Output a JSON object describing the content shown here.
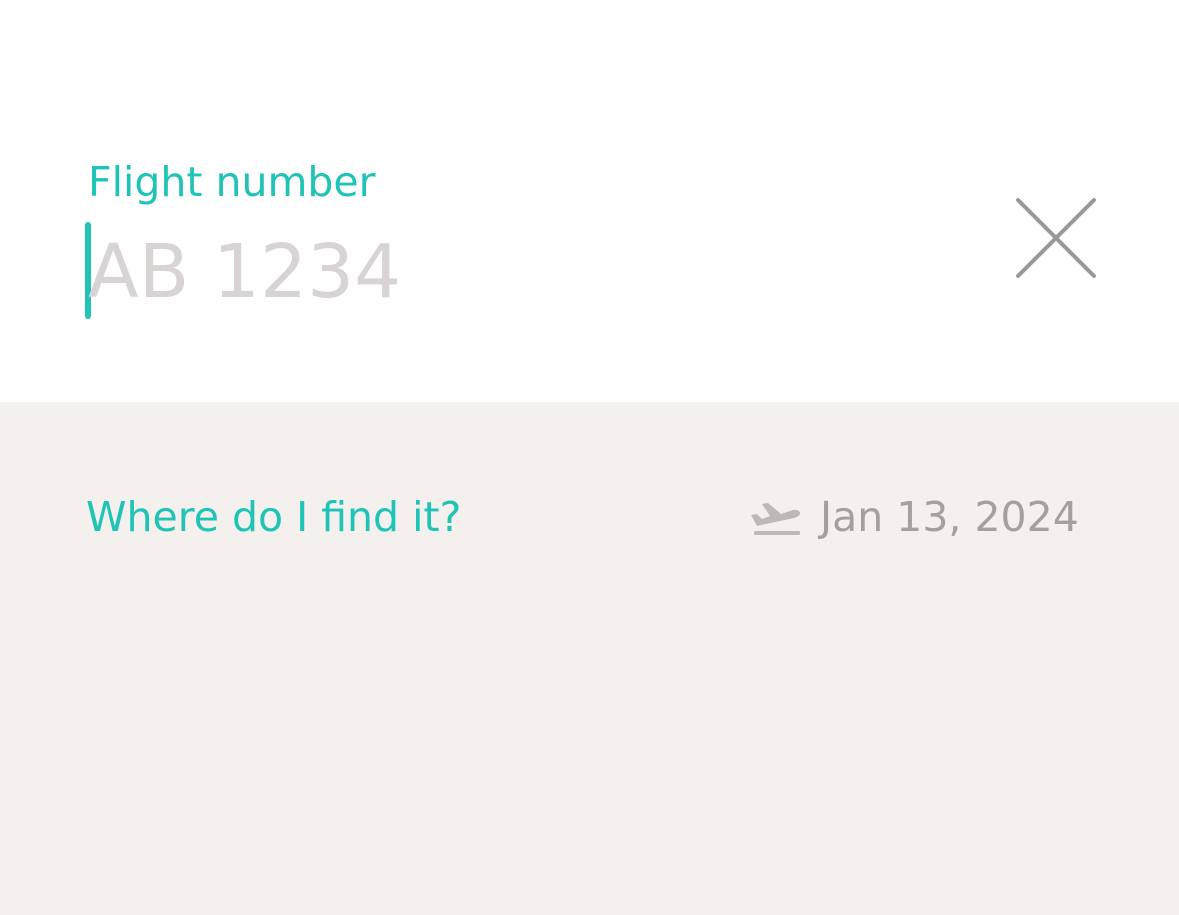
{
  "flight_form": {
    "label": "Flight number",
    "input_value": "",
    "input_placeholder": "AB 1234",
    "clear_icon": "close-icon"
  },
  "footer": {
    "help_link": "Where do I find it?",
    "departure_icon": "takeoff-icon",
    "departure_date": "Jan 13, 2024"
  },
  "colors": {
    "accent": "#1fc4b6",
    "placeholder": "#d8d4d4",
    "muted": "#a4a09e",
    "panel_background": "#ffffff",
    "page_background": "#f3f0ed"
  }
}
